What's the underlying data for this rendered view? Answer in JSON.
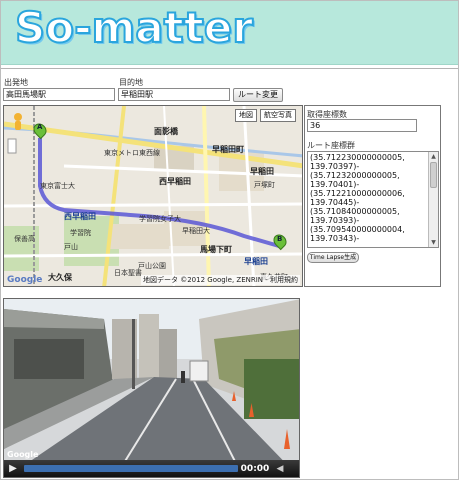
{
  "app": {
    "logo_text": "So-matter",
    "colors": {
      "header_bg": "#b7e8dc",
      "logo_fill": "#ffffff",
      "logo_stroke": "#2aa5dd",
      "route_line": "#5a57d6"
    }
  },
  "form": {
    "origin_label": "出発地",
    "origin_value": "高田馬場駅",
    "destination_label": "目的地",
    "destination_value": "早稲田駅",
    "change_route_button": "ルート変更"
  },
  "map": {
    "map_button": "地図",
    "satellite_button": "航空写真",
    "copyright": "地図データ ©2012 Google, ZENRIN - 利用規約",
    "google": "Google",
    "labels": {
      "omokage": "面影橋",
      "nishiwaseda": "西早稲田",
      "waseda_top": "早稲田町",
      "waseda_mid": "早稲田",
      "totsuka": "戸塚町",
      "nishiwaseda_station": "西早稲田",
      "gakushuin": "学習院女子大",
      "babashita": "馬場下町",
      "waseda_bottom": "早稲田",
      "okubo": "大久保",
      "toyama": "戸山公園",
      "metro": "東京メトロ東西線",
      "tokyo_fuji": "東京富士大",
      "hosei": "保善高",
      "gakushu": "学習院",
      "waseda_uni": "早稲田大",
      "kikui": "喜久井町",
      "toyama2": "戸山",
      "nihon_seikyo": "日本聖書",
      "marker_a": "A",
      "marker_b": "B"
    }
  },
  "panel": {
    "count_label": "取得座標数",
    "count_value": "36",
    "coords_label": "ルート座標群",
    "coords": [
      "(35.712230000000005,",
      "139.70397)-",
      "(35.71232000000005,",
      "139.70401)-",
      "(35.712210000000006,",
      "139.70445)-",
      "(35.71084000000005,",
      "139.70393)-",
      "(35.709540000000004,",
      "139.70343)-"
    ],
    "timelapse_button": "Time Lapse生成"
  },
  "video": {
    "time": "00:00",
    "progress": 0,
    "google": "Google"
  }
}
